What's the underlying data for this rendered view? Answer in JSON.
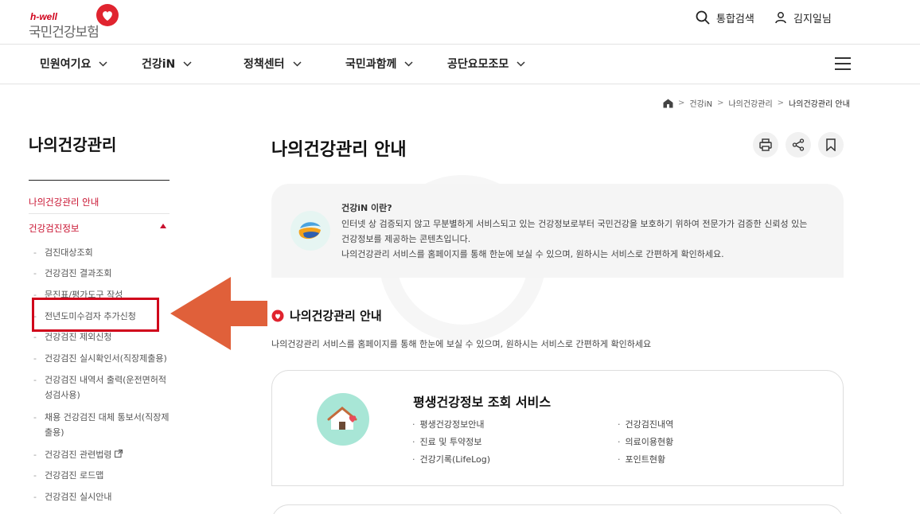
{
  "header": {
    "logo_small": "h-well",
    "logo_main": "국민건강보험",
    "search_label": "통합검색",
    "user_label": "김지일님"
  },
  "gnb": {
    "items": [
      {
        "label": "민원여기요"
      },
      {
        "label": "건강iN"
      },
      {
        "label": "정책센터"
      },
      {
        "label": "국민과함께"
      },
      {
        "label": "공단요모조모"
      }
    ]
  },
  "breadcrumb": [
    "건강iN",
    "나의건강관리",
    "나의건강관리 안내"
  ],
  "lnb": {
    "title": "나의건강관리",
    "link1": "나의건강관리 안내",
    "link2": "건강검진정보",
    "sub_items": [
      "검진대상조회",
      "건강검진 결과조회",
      "문진표/평가도구 작성",
      "전년도미수검자 추가신청",
      "건강검진 제외신청",
      "건강검진 실시확인서(직장제출용)",
      "건강검진 내역서 출력(운전면허적성검사용)",
      "채용 건강검진 대체 통보서(직장제출용)",
      "건강검진 관련법령",
      "건강검진 로드맵",
      "건강검진 실시안내"
    ]
  },
  "main": {
    "title": "나의건강관리 안내",
    "info": {
      "heading": "건강iN 이란?",
      "line1": "인터넷 상 검증되지 않고 무분별하게 서비스되고 있는 건강정보로부터 국민건강을 보호하기 위하여 전문가가 검증한 신뢰성 있는",
      "line2": "건강정보를 제공하는 콘텐츠입니다.",
      "line3": "나의건강관리 서비스를 홈페이지를 통해 한눈에 보실 수 있으며, 원하시는 서비스로 간편하게 확인하세요."
    },
    "section_title": "나의건강관리 안내",
    "section_desc": "나의건강관리 서비스를 홈페이지를 통해 한눈에 보실 수 있으며, 원하시는 서비스로 간편하게 확인하세요",
    "card": {
      "title": "평생건강정보 조회 서비스",
      "col1": [
        "평생건강정보안내",
        "진료 및 투약정보",
        "건강기록(LifeLog)"
      ],
      "col2": [
        "건강검진내역",
        "의료이용현황",
        "포인트현황"
      ]
    }
  },
  "colors": {
    "accent": "#c8102e",
    "highlight_box": "#d0021b",
    "arrow": "#e0603a"
  }
}
